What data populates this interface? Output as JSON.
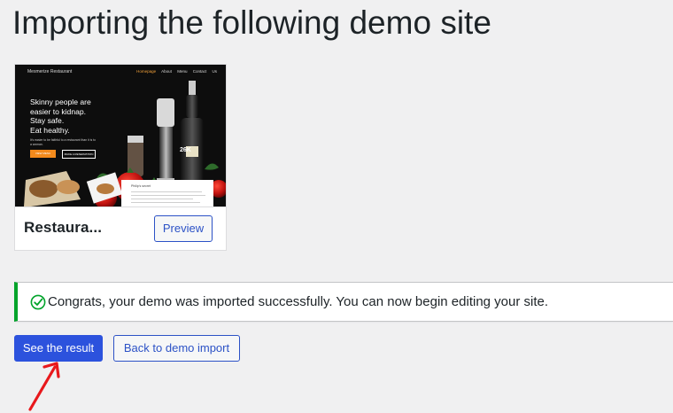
{
  "page": {
    "title": "Importing the following demo site"
  },
  "demo": {
    "name": "Restaura...",
    "preview_label": "Preview",
    "thumbnail": {
      "site_name": "Mesmerize Restaurant",
      "nav_links": [
        "Homepage",
        "About",
        "Menu",
        "Contact Us"
      ],
      "headline": "Skinny people are\neasier to kidnap.\nStay safe.\nEat healthy.",
      "subline": "It's easier to be faithful to a restaurant than it is to a woman.",
      "cta_primary": "VIEW MENU",
      "cta_secondary": "MAKE A RESERVATION",
      "panel_title": "Philip's secret",
      "price_tag": "26K"
    }
  },
  "notice": {
    "text": "Congrats, your demo was imported successfully. You can now begin editing your site.",
    "icon": "check-circle-icon",
    "color": "#00a32a"
  },
  "actions": {
    "primary_label": "See the result",
    "secondary_label": "Back to demo import"
  },
  "colors": {
    "accent": "#2c52dd",
    "annotation": "#e8181c",
    "success": "#00a32a"
  }
}
